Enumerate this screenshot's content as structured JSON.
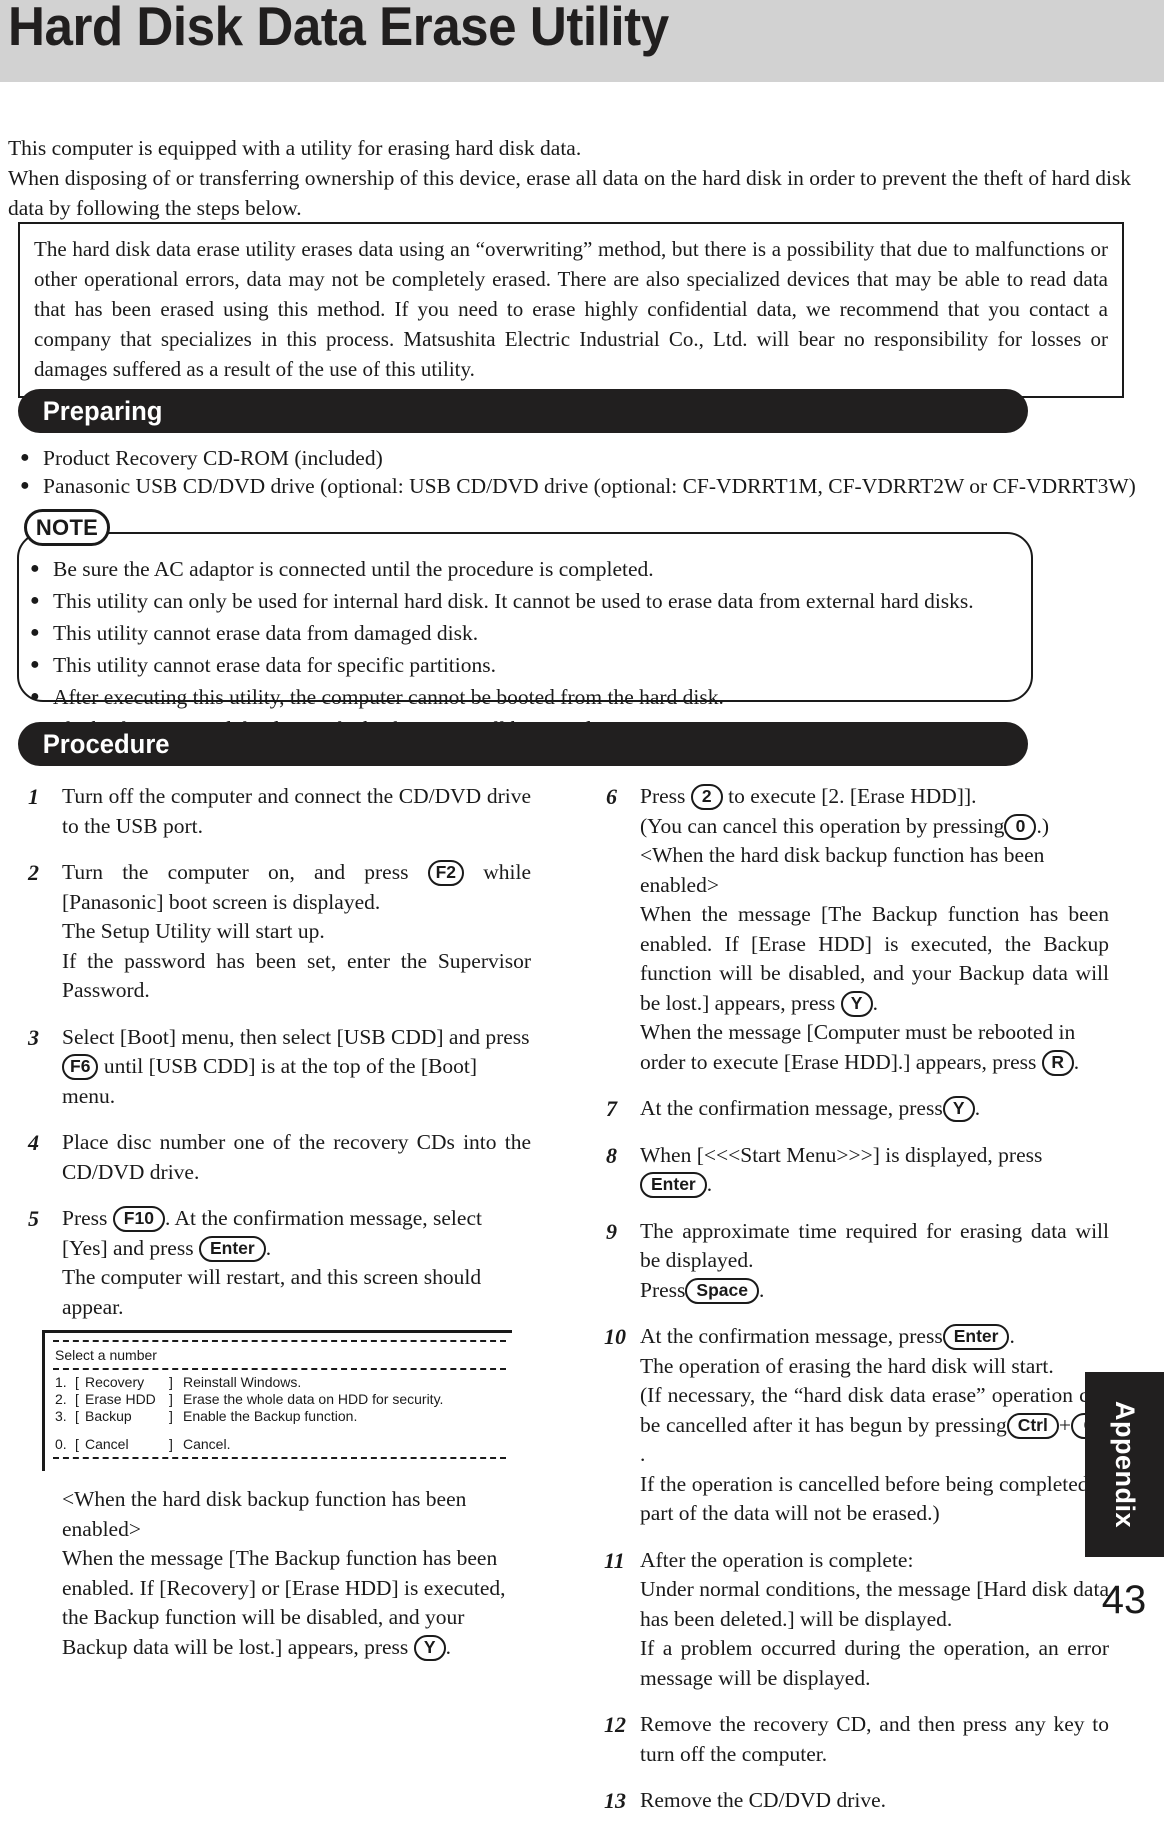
{
  "title": "Hard Disk Data Erase Utility",
  "intro": {
    "line1": "This computer is equipped with a utility for erasing hard disk data.",
    "line2": "When disposing of or transferring ownership of this device, erase all data on the hard disk in order to prevent the theft of hard disk data by following the steps below."
  },
  "caution": {
    "text": "The hard disk data erase utility erases data using an “overwriting” method, but there is a possibility that due to malfunctions or other operational errors, data may not be completely erased. There are also specialized devices that may be able to read data that has been erased using this method. If you need to erase highly confidential data, we recommend that you contact a company that specializes in this process. Matsushita Electric Industrial Co., Ltd. will bear no responsibility for losses or damages suffered as a result of the use of this utility."
  },
  "preparing": {
    "heading": "Preparing",
    "items": [
      "Product Recovery CD-ROM (included)",
      "Panasonic USB CD/DVD drive (optional:  USB CD/DVD drive (optional:  CF-VDRRT1M, CF-VDRRT2W or CF-VDRRT3W)"
    ]
  },
  "note": {
    "label": "NOTE",
    "items": [
      "Be sure the AC adaptor is connected until the procedure is completed.",
      "This utility can only be used for internal hard disk.  It cannot be used to erase data from external hard disks.",
      "This utility cannot erase data from damaged disk.",
      "This utility cannot erase data for specific partitions.",
      "After executing this utility, the computer cannot be booted from the hard disk.",
      "The backup area and the data in the backup area will be erased."
    ]
  },
  "procedure": {
    "heading": "Procedure",
    "steps": {
      "s1": {
        "num": "1",
        "text": "Turn off the computer and connect the CD/DVD drive to the USB port."
      },
      "s2": {
        "num": "2",
        "t1": "Turn the computer on, and press",
        "key": "F2",
        "t2": "while [Panasonic] boot screen is displayed.",
        "t3": "The Setup Utility will start up.",
        "t4": "If the password has been set, enter the Supervisor Password."
      },
      "s3": {
        "num": "3",
        "t1": "Select [Boot] menu, then select [USB CDD] and press",
        "key": "F6",
        "t2": "until [USB CDD] is at the top of the [Boot] menu."
      },
      "s4": {
        "num": "4",
        "text": "Place disc number one of the recovery CDs into the CD/DVD drive."
      },
      "s5": {
        "num": "5",
        "t1": "Press",
        "key1": "F10",
        "t2": ".  At the confirmation message, select [Yes] and press",
        "key2": "Enter",
        "t3": ".",
        "t4": "The computer will restart, and this screen should appear.",
        "after1": "<When the hard disk backup function has been enabled>",
        "after2": "When the message [The Backup function has been enabled. If [Recovery] or [Erase HDD] is executed, the Backup function will be disabled, and your Backup data will be lost.] appears, press",
        "key3": "Y",
        "after3": "."
      },
      "s6": {
        "num": "6",
        "t1": "Press",
        "key1": "2",
        "t2": "to execute [2. [Erase HDD]].",
        "t3": "(You can cancel this operation by pressing",
        "key2": "0",
        "t4": ".)",
        "t5": "<When the hard disk backup function has been enabled>",
        "t6": "When the message [The Backup function has been enabled. If [Erase HDD] is executed, the Backup function will be disabled, and your Backup data will be lost.] appears, press",
        "key3": "Y",
        "t7": ".",
        "t8": "When the message [Computer must be rebooted in order to execute [Erase HDD].] appears, press",
        "key4": "R",
        "t9": "."
      },
      "s7": {
        "num": "7",
        "t1": "At the confirmation message, press",
        "key": "Y",
        "t2": "."
      },
      "s8": {
        "num": "8",
        "t1": "When [<<<Start Menu>>>] is displayed, press",
        "key": "Enter",
        "t2": "."
      },
      "s9": {
        "num": "9",
        "t1": "The approximate time required for erasing data will be displayed.",
        "t2": "Press",
        "key": "Space",
        "t3": "."
      },
      "s10": {
        "num": "10",
        "t1": "At the confirmation message, press",
        "key1": "Enter",
        "t2": ".",
        "t3": "The operation of erasing the hard disk will start.",
        "t4": "(If necessary, the “hard disk data erase” operation can be cancelled after it has begun by pressing",
        "key2": "Ctrl",
        "plus": "+",
        "key3": "C",
        "t5": ".",
        "t6": "If the operation is cancelled before being completed, a part of the data will not be erased.)"
      },
      "s11": {
        "num": "11",
        "t1": "After the operation is complete:",
        "t2": "Under normal conditions, the message [Hard disk data has been deleted.] will be displayed.",
        "t3": "If a problem occurred during the operation, an error message will be displayed."
      },
      "s12": {
        "num": "12",
        "text": "Remove the recovery CD, and then press any key to turn off the computer."
      },
      "s13": {
        "num": "13",
        "text": "Remove the CD/DVD drive."
      }
    }
  },
  "boot_screen": {
    "title": "Select a number",
    "rows": [
      {
        "idx": "1.",
        "bracket_l": "[",
        "name": "Recovery",
        "bracket_r": "]",
        "desc": "Reinstall Windows."
      },
      {
        "idx": "2.",
        "bracket_l": "[",
        "name": "Erase HDD",
        "bracket_r": "]",
        "desc": "Erase the whole data on HDD for security."
      },
      {
        "idx": "3.",
        "bracket_l": "[",
        "name": "Backup",
        "bracket_r": "]",
        "desc": "Enable the Backup function."
      }
    ],
    "cancel": {
      "idx": "0.",
      "bracket_l": "[",
      "name": "Cancel",
      "bracket_r": "]",
      "desc": "Cancel."
    }
  },
  "footer": {
    "appendix": "Appendix",
    "page_number": "43"
  }
}
